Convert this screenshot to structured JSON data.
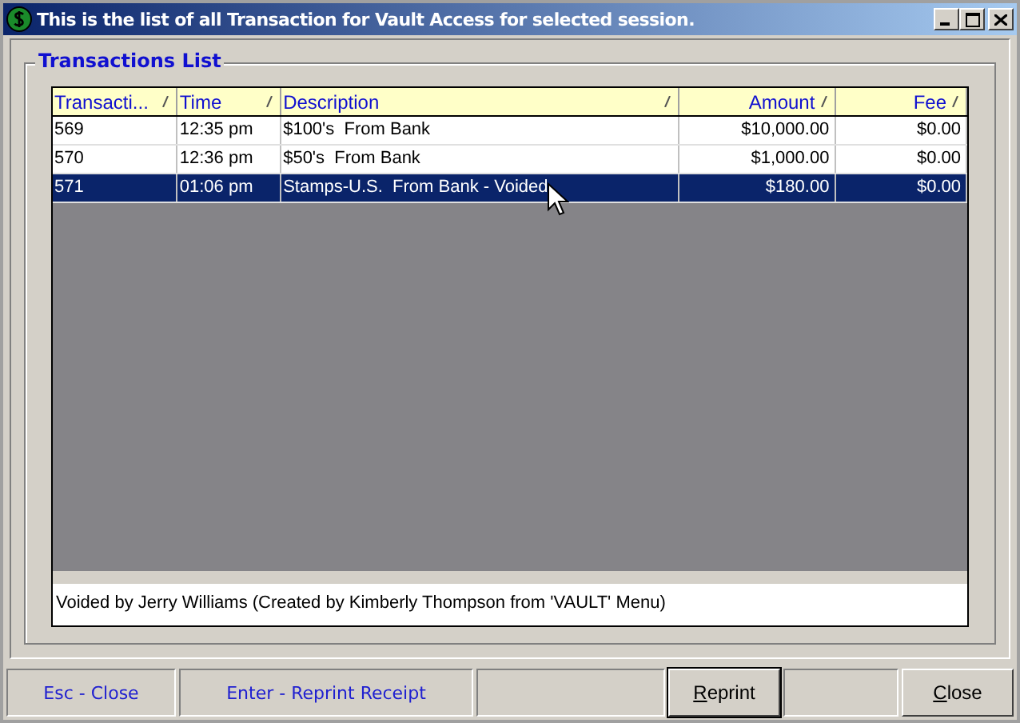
{
  "window": {
    "title": "This is the list of all Transaction for Vault Access for selected session."
  },
  "group": {
    "title": "Transactions List"
  },
  "table": {
    "columns": [
      {
        "label": "Transacti...",
        "kind": "text"
      },
      {
        "label": "Time",
        "kind": "text"
      },
      {
        "label": "Description",
        "kind": "text"
      },
      {
        "label": "Amount",
        "kind": "money"
      },
      {
        "label": "Fee",
        "kind": "money"
      }
    ],
    "rows": [
      {
        "cells": [
          "569",
          "12:35 pm",
          "$100's  From Bank",
          "$10,000.00",
          "$0.00"
        ],
        "selected": false
      },
      {
        "cells": [
          "570",
          "12:36 pm",
          "$50's  From Bank",
          "$1,000.00",
          "$0.00"
        ],
        "selected": false
      },
      {
        "cells": [
          "571",
          "01:06 pm",
          "Stamps-U.S.  From Bank - Voided",
          "$180.00",
          "$0.00"
        ],
        "selected": true
      }
    ]
  },
  "note": "Voided by Jerry Williams (Created by Kimberly Thompson from 'VAULT' Menu)",
  "status_bar": {
    "hints": [
      "Esc - Close",
      "Enter - Reprint Receipt"
    ],
    "buttons": [
      "Reprint",
      "Close"
    ]
  }
}
